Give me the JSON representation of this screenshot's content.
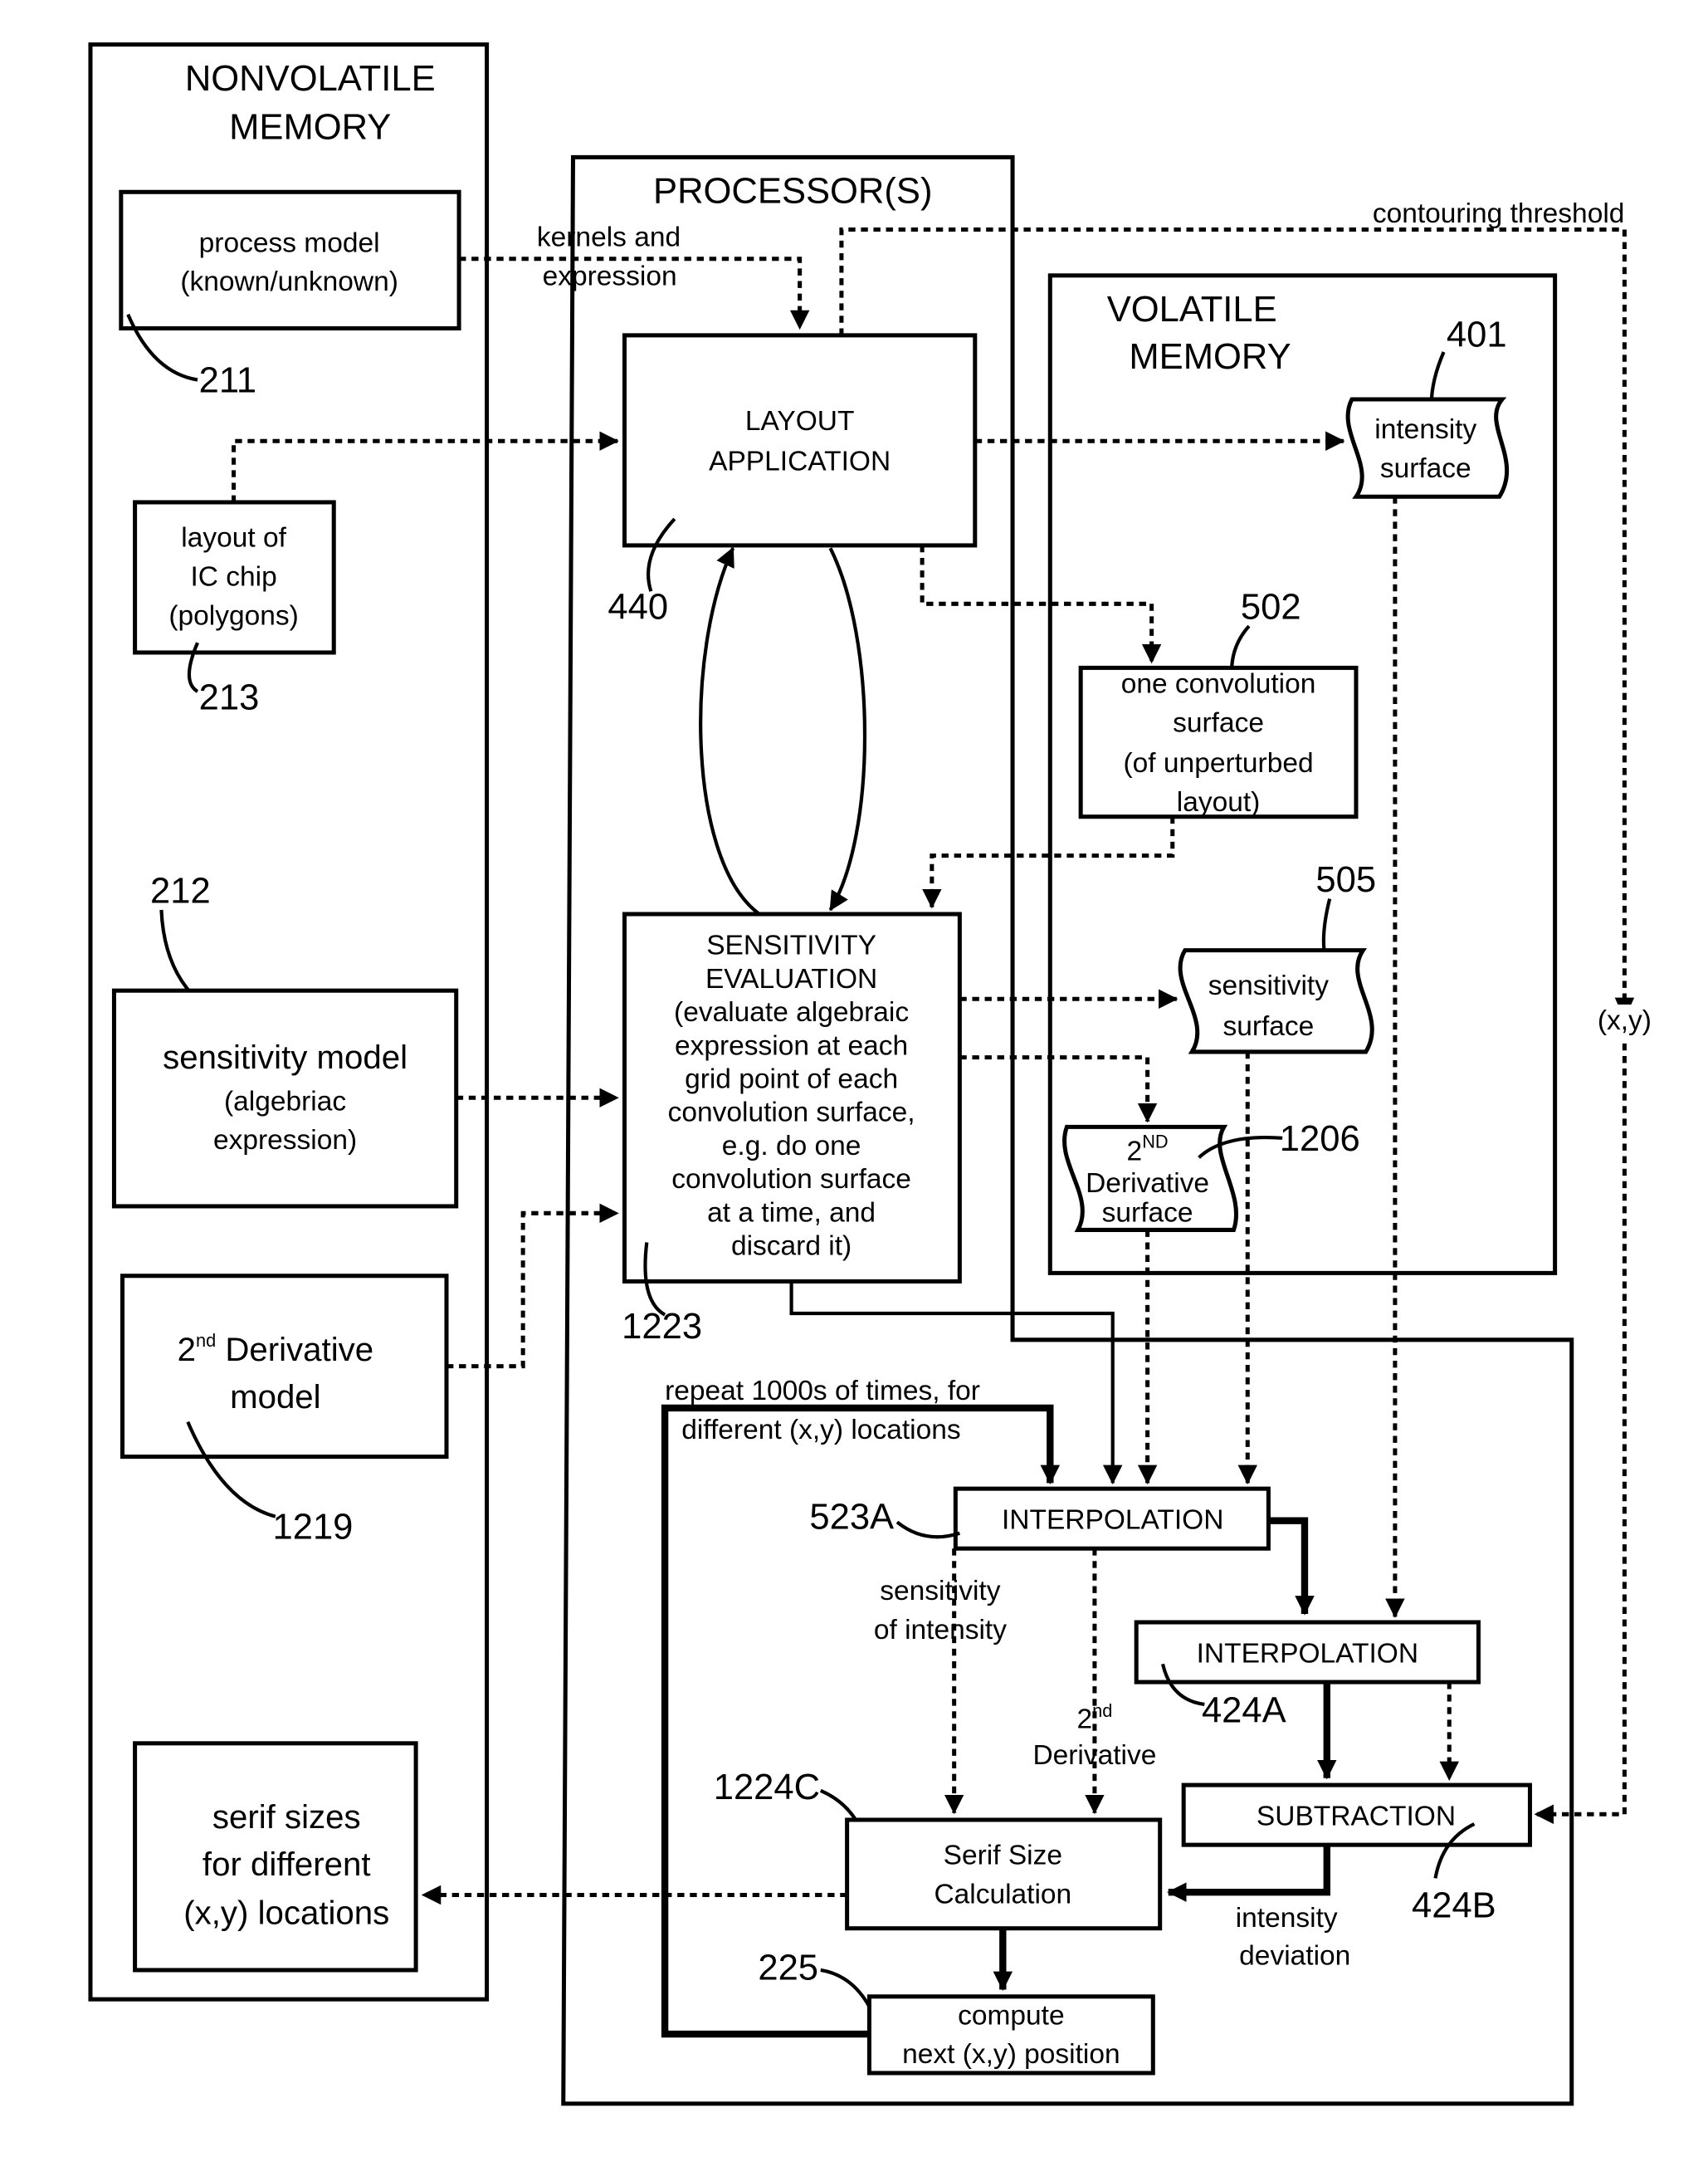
{
  "figure": {
    "nonvolatile": {
      "title_line1": "NONVOLATILE",
      "title_line2": "MEMORY",
      "process_model": {
        "line1": "process model",
        "line2": "(known/unknown)",
        "ref": "211"
      },
      "layout_ic": {
        "line1": "layout of",
        "line2": "IC chip",
        "line3": "(polygons)",
        "ref": "213"
      },
      "sensitivity_model": {
        "line1": "sensitivity model",
        "line2": "(algebriac",
        "line3": "expression)",
        "ref": "212"
      },
      "derivative_model": {
        "base": "2",
        "sup": "nd",
        "line1_rest": " Derivative",
        "line2": "model",
        "ref": "1219"
      },
      "serif_sizes": {
        "line1": "serif sizes",
        "line2": "for different",
        "line3": "(x,y) locations"
      }
    },
    "processor": {
      "title": "PROCESSOR(S)",
      "layout_application": {
        "line1": "LAYOUT",
        "line2": "APPLICATION",
        "ref": "440"
      },
      "sensitivity_evaluation": {
        "lines": [
          "SENSITIVITY",
          "EVALUATION",
          "(evaluate algebraic",
          "expression at each",
          "grid point of each",
          "convolution surface,",
          "e.g. do one",
          "convolution surface",
          "at a time, and",
          "discard it)"
        ],
        "ref": "1223"
      }
    },
    "volatile": {
      "title_line1": "VOLATILE",
      "title_line2": "MEMORY",
      "intensity_surface": {
        "line1": "intensity",
        "line2": "surface",
        "ref": "401"
      },
      "convolution_surface": {
        "line1": "one convolution",
        "line2": "surface",
        "line3": "(of unperturbed",
        "line4": "layout)",
        "ref": "502"
      },
      "sensitivity_surface": {
        "line1": "sensitivity",
        "line2": "surface",
        "ref": "505"
      },
      "derivative_surface": {
        "base": "2",
        "sup": "ND",
        "line2": "Derivative",
        "line3": "surface",
        "ref": "1206"
      }
    },
    "loop": {
      "label_line1": "repeat 1000s of times, for",
      "label_line2": "different (x,y) locations",
      "interpolation_1": {
        "label": "INTERPOLATION",
        "ref": "523A"
      },
      "interpolation_2": {
        "label": "INTERPOLATION",
        "ref": "424A"
      },
      "subtraction": {
        "label": "SUBTRACTION",
        "ref": "424B"
      },
      "serif_calc": {
        "line1": "Serif Size",
        "line2": "Calculation",
        "ref": "1224C"
      },
      "compute_next": {
        "line1": "compute",
        "line2": "next (x,y) position",
        "ref": "225"
      }
    },
    "edge_labels": {
      "kernels_line1": "kernels and",
      "kernels_line2": "expression",
      "contouring_threshold": "contouring threshold",
      "xy": "(x,y)",
      "sensitivity_of_intensity_1": "sensitivity",
      "sensitivity_of_intensity_2": "of intensity",
      "second_derivative_base": "2",
      "second_derivative_sup": "nd",
      "second_derivative_2": "Derivative",
      "intensity_deviation_1": "intensity",
      "intensity_deviation_2": "deviation"
    }
  }
}
